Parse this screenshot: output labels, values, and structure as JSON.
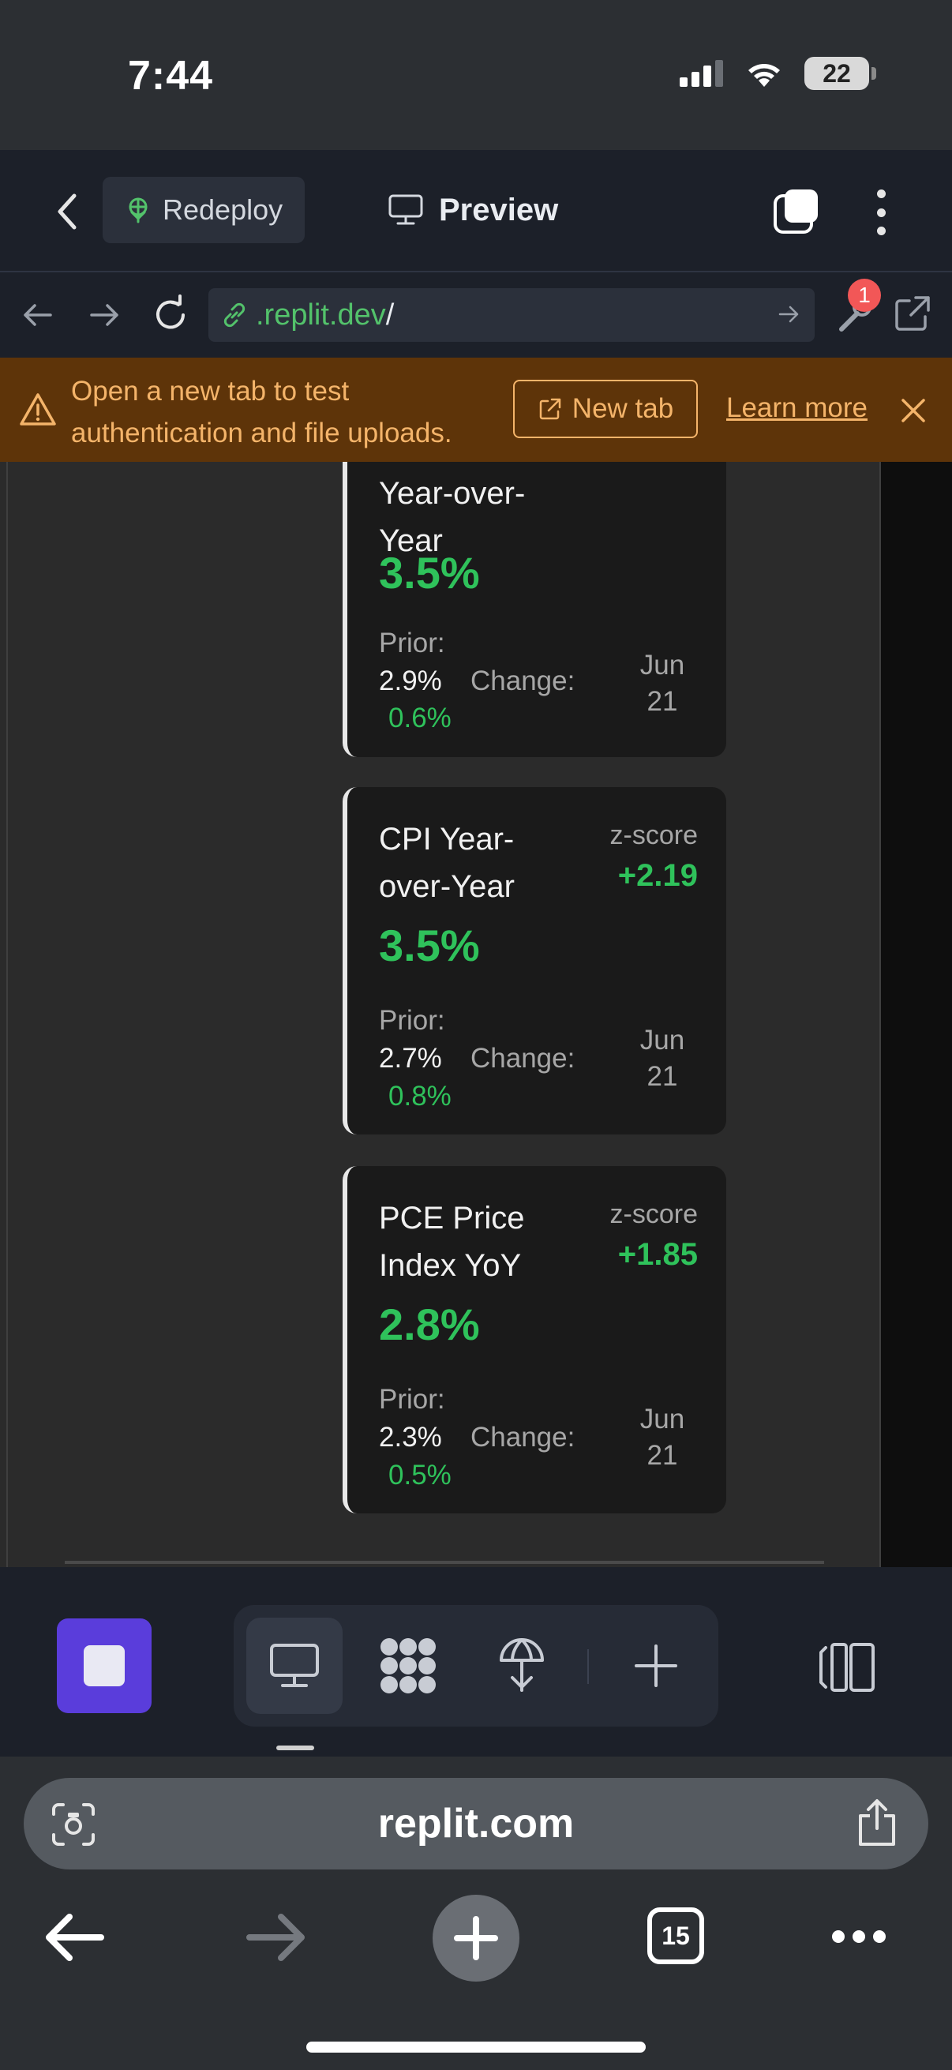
{
  "status_bar": {
    "time": "7:44",
    "battery": "22"
  },
  "header": {
    "redeploy_label": "Redeploy",
    "preview_label": "Preview"
  },
  "url_bar": {
    "url_host": ".replit.dev",
    "url_path": "/",
    "devtools_badge": "1"
  },
  "banner": {
    "message": "Open a new tab to test authentication and file uploads.",
    "new_tab_label": "New tab",
    "learn_more_label": "Learn more"
  },
  "cards": [
    {
      "title": "Year-over-Year",
      "value": "3.5%",
      "prior_label": "Prior:",
      "prior_value": "2.9%",
      "change_label": "Change:",
      "change_value": "0.6%",
      "date": "Jun 21"
    },
    {
      "title": "CPI Year-over-Year",
      "value": "3.5%",
      "z_label": "z-score",
      "z_value": "+2.19",
      "prior_label": "Prior:",
      "prior_value": "2.7%",
      "change_label": "Change:",
      "change_value": "0.8%",
      "date": "Jun 21"
    },
    {
      "title": "PCE Price Index YoY",
      "value": "2.8%",
      "z_label": "z-score",
      "z_value": "+1.85",
      "prior_label": "Prior:",
      "prior_value": "2.3%",
      "change_label": "Change:",
      "change_value": "0.5%",
      "date": "Jun 21"
    }
  ],
  "safari": {
    "url": "replit.com",
    "tab_count": "15"
  },
  "colors": {
    "accent_green": "#2fc25b",
    "banner_bg": "#5e3409",
    "banner_fg": "#f4b46a",
    "stop_button": "#5a3ddb"
  },
  "icons": [
    "signal-icon",
    "wifi-icon",
    "battery-icon",
    "chevron-left-icon",
    "deploy-icon",
    "monitor-icon",
    "window-icon",
    "more-vertical-icon",
    "arrow-left-icon",
    "arrow-right-icon",
    "reload-icon",
    "link-icon",
    "wrench-icon",
    "external-link-icon",
    "warning-icon",
    "close-icon",
    "stop-icon",
    "apps-icon",
    "plus-icon",
    "panel-icon",
    "scan-icon",
    "share-icon"
  ]
}
